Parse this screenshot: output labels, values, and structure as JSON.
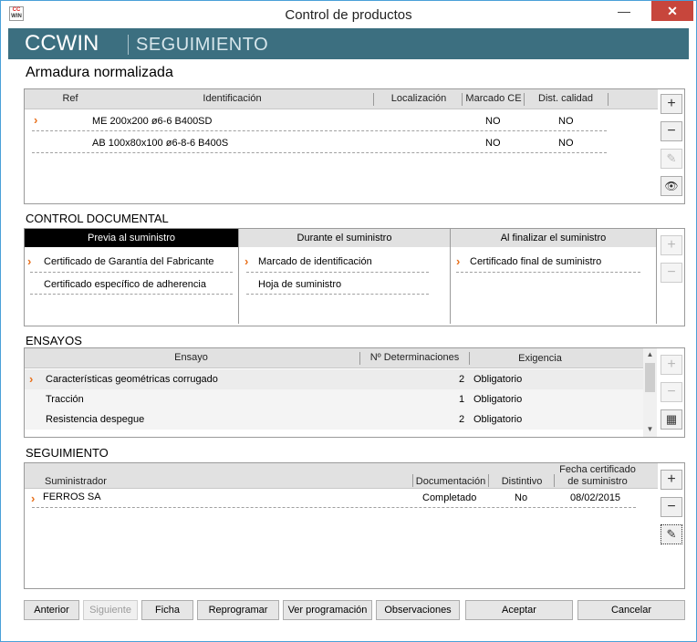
{
  "window": {
    "title": "Control de productos"
  },
  "banner": {
    "brand": "CCWIN",
    "subtitle": "SEGUIMIENTO"
  },
  "page_title": "Armadura normalizada",
  "armadura": {
    "columns": [
      "Ref",
      "Identificación",
      "Localización",
      "Marcado CE",
      "Dist. calidad"
    ],
    "rows": [
      {
        "id": "ME 200x200 ø6-6 B400SD",
        "ce": "NO",
        "dist": "NO"
      },
      {
        "id": "AB 100x80x100 ø6-8-6 B400S",
        "ce": "NO",
        "dist": "NO"
      }
    ]
  },
  "control_documental": {
    "label": "CONTROL DOCUMENTAL",
    "tabs": [
      {
        "title": "Previa al suministro",
        "items": [
          "Certificado de Garantía del Fabricante",
          "Certificado específico de adherencia"
        ]
      },
      {
        "title": "Durante el suministro",
        "items": [
          "Marcado de identificación",
          "Hoja de suministro"
        ]
      },
      {
        "title": "Al finalizar el suministro",
        "items": [
          "Certificado final de suministro"
        ]
      }
    ]
  },
  "ensayos": {
    "label": "ENSAYOS",
    "columns": [
      "Ensayo",
      "Nº Determinaciones",
      "Exigencia"
    ],
    "rows": [
      {
        "name": "Características geométricas corrugado",
        "n": "2",
        "req": "Obligatorio"
      },
      {
        "name": "Tracción",
        "n": "1",
        "req": "Obligatorio"
      },
      {
        "name": "Resistencia despegue",
        "n": "2",
        "req": "Obligatorio"
      }
    ]
  },
  "seguimiento": {
    "label": "SEGUIMIENTO",
    "columns": [
      "Suministrador",
      "Documentación",
      "Distintivo",
      "Fecha certificado",
      "de suministro"
    ],
    "rows": [
      {
        "sup": "FERROS SA",
        "doc": "Completado",
        "dist": "No",
        "date": "08/02/2015"
      }
    ]
  },
  "buttons": {
    "anterior": "Anterior",
    "siguiente": "Siguiente",
    "ficha": "Ficha",
    "reprogramar": "Reprogramar",
    "ver": "Ver programación",
    "obs": "Observaciones",
    "aceptar": "Aceptar",
    "cancelar": "Cancelar"
  },
  "icons": {
    "add": "+",
    "remove": "−",
    "edit": "✎",
    "view": "👁",
    "calc": "▦",
    "arrow": "›",
    "scroll_up": "▲",
    "scroll_down": "▼",
    "minimize": "—",
    "maximize": "☐",
    "close": "✕"
  },
  "colors": {
    "banner": "#3c6f80",
    "arrow": "#e8701b",
    "close": "#c7463c"
  }
}
